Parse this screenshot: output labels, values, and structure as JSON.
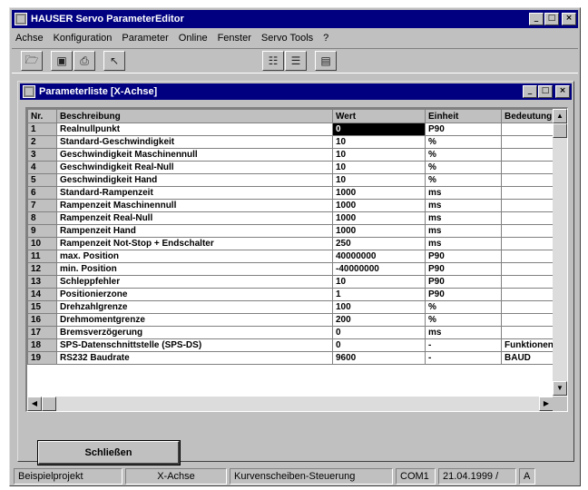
{
  "window": {
    "title": "HAUSER Servo ParameterEditor",
    "buttons": {
      "minimize": "_",
      "maximize": "□",
      "close": "×"
    }
  },
  "menu": [
    "Achse",
    "Konfiguration",
    "Parameter",
    "Online",
    "Fenster",
    "Servo Tools",
    "?"
  ],
  "toolbar": {
    "icons": [
      "open-icon",
      "save-icon",
      "print-icon",
      "cursor-icon",
      "table-icon",
      "list-icon",
      "disk-icon"
    ]
  },
  "child_window": {
    "title": "Parameterliste [X-Achse]",
    "buttons": {
      "minimize": "_",
      "maximize": "□",
      "close": "×"
    }
  },
  "table": {
    "columns": [
      "Nr.",
      "Beschreibung",
      "Wert",
      "Einheit",
      "Bedeutung"
    ],
    "rows": [
      {
        "nr": "1",
        "beschreibung": "Realnullpunkt",
        "wert": "0",
        "einheit": "P90",
        "bedeutung": ""
      },
      {
        "nr": "2",
        "beschreibung": "Standard-Geschwindigkeit",
        "wert": "10",
        "einheit": "%",
        "bedeutung": ""
      },
      {
        "nr": "3",
        "beschreibung": "Geschwindigkeit Maschinennull",
        "wert": "10",
        "einheit": "%",
        "bedeutung": ""
      },
      {
        "nr": "4",
        "beschreibung": "Geschwindigkeit Real-Null",
        "wert": "10",
        "einheit": "%",
        "bedeutung": ""
      },
      {
        "nr": "5",
        "beschreibung": "Geschwindigkeit Hand",
        "wert": "10",
        "einheit": "%",
        "bedeutung": ""
      },
      {
        "nr": "6",
        "beschreibung": "Standard-Rampenzeit",
        "wert": "1000",
        "einheit": "ms",
        "bedeutung": ""
      },
      {
        "nr": "7",
        "beschreibung": "Rampenzeit Maschinennull",
        "wert": "1000",
        "einheit": "ms",
        "bedeutung": ""
      },
      {
        "nr": "8",
        "beschreibung": "Rampenzeit Real-Null",
        "wert": "1000",
        "einheit": "ms",
        "bedeutung": ""
      },
      {
        "nr": "9",
        "beschreibung": "Rampenzeit Hand",
        "wert": "1000",
        "einheit": "ms",
        "bedeutung": ""
      },
      {
        "nr": "10",
        "beschreibung": "Rampenzeit Not-Stop + Endschalter",
        "wert": "250",
        "einheit": "ms",
        "bedeutung": ""
      },
      {
        "nr": "11",
        "beschreibung": "max. Position",
        "wert": "40000000",
        "einheit": "P90",
        "bedeutung": ""
      },
      {
        "nr": "12",
        "beschreibung": "min. Position",
        "wert": "-40000000",
        "einheit": "P90",
        "bedeutung": ""
      },
      {
        "nr": "13",
        "beschreibung": "Schleppfehler",
        "wert": "10",
        "einheit": "P90",
        "bedeutung": ""
      },
      {
        "nr": "14",
        "beschreibung": "Positionierzone",
        "wert": "1",
        "einheit": "P90",
        "bedeutung": ""
      },
      {
        "nr": "15",
        "beschreibung": "Drehzahlgrenze",
        "wert": "100",
        "einheit": "%",
        "bedeutung": ""
      },
      {
        "nr": "16",
        "beschreibung": "Drehmomentgrenze",
        "wert": "200",
        "einheit": "%",
        "bedeutung": ""
      },
      {
        "nr": "17",
        "beschreibung": "Bremsverzögerung",
        "wert": "0",
        "einheit": "ms",
        "bedeutung": ""
      },
      {
        "nr": "18",
        "beschreibung": "SPS-Datenschnittstelle (SPS-DS)",
        "wert": "0",
        "einheit": "-",
        "bedeutung": "Funktionen"
      },
      {
        "nr": "19",
        "beschreibung": "RS232 Baudrate",
        "wert": "9600",
        "einheit": "-",
        "bedeutung": "BAUD"
      }
    ],
    "selected_row": 1
  },
  "close_button": "Schließen",
  "statusbar": [
    "Beispielprojekt",
    "X-Achse",
    "Kurvenscheiben-Steuerung",
    "COM1",
    "21.04.1999 /",
    "A"
  ]
}
